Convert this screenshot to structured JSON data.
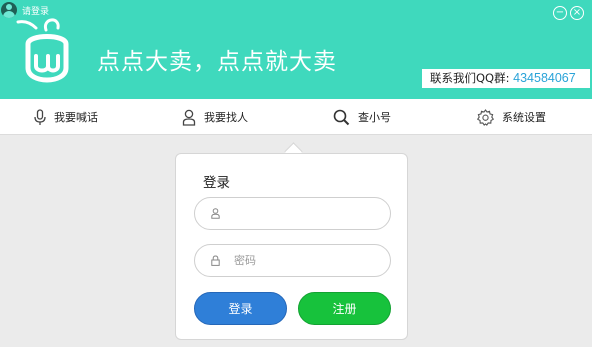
{
  "window": {
    "title": "请登录",
    "minimize_glyph": "−",
    "close_glyph": "×"
  },
  "header": {
    "slogan": "点点大卖，点点就大卖",
    "qq_label": "联系我们QQ群:",
    "qq_number": "434584067",
    "background_color": "#3fd9bd"
  },
  "nav": {
    "items": [
      {
        "label": "我要喊话",
        "icon": "microphone-icon"
      },
      {
        "label": "我要找人",
        "icon": "person-icon"
      },
      {
        "label": "查小号",
        "icon": "search-icon"
      },
      {
        "label": "系统设置",
        "icon": "gear-icon"
      }
    ]
  },
  "login": {
    "title": "登录",
    "username_placeholder": "",
    "password_placeholder": "密码",
    "login_button": "登录",
    "register_button": "注册",
    "login_color": "#2f7fd8",
    "register_color": "#17c23c"
  }
}
